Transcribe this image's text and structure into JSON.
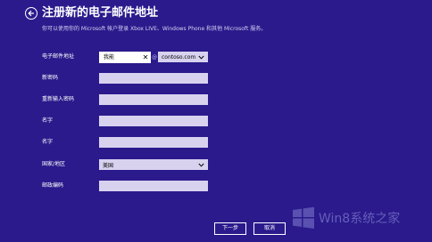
{
  "header": {
    "title": "注册新的电子邮件地址",
    "subtitle": "你可以使用你的 Microsoft 帐户登录 Xbox LIVE、Windows Phone 和其他 Microsoft 服务。"
  },
  "form": {
    "email_label": "电子邮件地址",
    "email_value": "我能",
    "at": "@",
    "domain_value": "contoso.com",
    "password_label": "新密码",
    "reenter_label": "重新输入密码",
    "firstname_label": "名字",
    "lastname_label": "名字",
    "country_label": "国家/地区",
    "country_value": "美国",
    "zip_label": "邮政编码"
  },
  "buttons": {
    "next": "下一步",
    "cancel": "取消"
  },
  "watermark": {
    "text": "Win8系统之家"
  },
  "colors": {
    "background": "#2a1a8c",
    "field": "#d8d2ef",
    "text": "#ffffff"
  }
}
